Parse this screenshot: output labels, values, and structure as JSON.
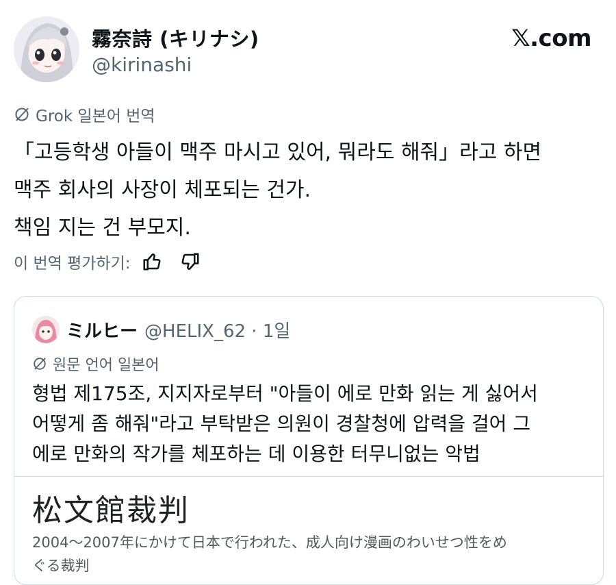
{
  "author": {
    "name": "霧奈詩 (キリナシ)",
    "handle": "@kirinashi"
  },
  "site": "𝕏.com",
  "translation": {
    "label": "Grok 일본어 번역",
    "icon": "translation-icon"
  },
  "body_lines": [
    "「고등학생 아들이 맥주 마시고 있어, 뭐라도 해줘」라고 하면",
    "맥주 회사의 사장이 체포되는 건가.",
    "책임 지는 건 부모지."
  ],
  "rating": {
    "label": "이 번역 평가하기:",
    "like_icon": "thumbs-up-icon",
    "dislike_icon": "thumbs-down-icon"
  },
  "quote": {
    "name": "ミルヒー",
    "handle_time": "@HELIX_62 · 1일",
    "lang_label": "원문 언어 일본어",
    "lines": [
      "형법 제175조, 지지자로부터 \"아들이 에로 만화 읽는 게 싫어서",
      "어떻게 좀 해줘\"라고 부탁받은 의원이 경찰청에 압력을 걸어 그",
      "에로 만화의 작가를 체포하는 데 이용한 터무니없는 악법"
    ],
    "embed_title": "松文館裁判",
    "embed_desc": [
      "2004〜2007年にかけて日本で行われた、成人向け漫画のわいせつ性をめ",
      "ぐる裁判"
    ]
  }
}
